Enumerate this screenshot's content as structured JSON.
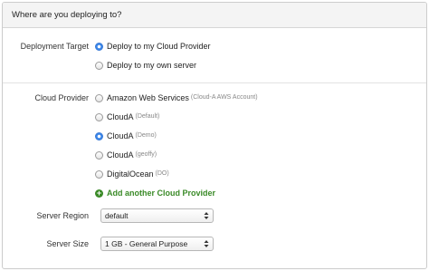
{
  "header": {
    "title": "Where are you deploying to?"
  },
  "deployment_target": {
    "label": "Deployment Target",
    "options": [
      {
        "text": "Deploy to my Cloud Provider",
        "checked": true
      },
      {
        "text": "Deploy to my own server",
        "checked": false
      }
    ]
  },
  "cloud_provider": {
    "label": "Cloud Provider",
    "options": [
      {
        "text": "Amazon Web Services",
        "hint": "(Cloud-A AWS Account)",
        "checked": false
      },
      {
        "text": "CloudA",
        "hint": "(Default)",
        "checked": false
      },
      {
        "text": "CloudA",
        "hint": "(Demo)",
        "checked": true
      },
      {
        "text": "CloudA",
        "hint": "(geoffy)",
        "checked": false
      },
      {
        "text": "DigitalOcean",
        "hint": "(DO)",
        "checked": false
      }
    ],
    "add_link": "Add another Cloud Provider"
  },
  "server_region": {
    "label": "Server Region",
    "value": "default"
  },
  "server_size": {
    "label": "Server Size",
    "value": "1 GB - General Purpose"
  },
  "colors": {
    "accent": "#3a86ea",
    "link_green": "#3a8a27"
  },
  "icons": {
    "add": "plus-circle-icon",
    "select": "select-arrows-icon"
  }
}
